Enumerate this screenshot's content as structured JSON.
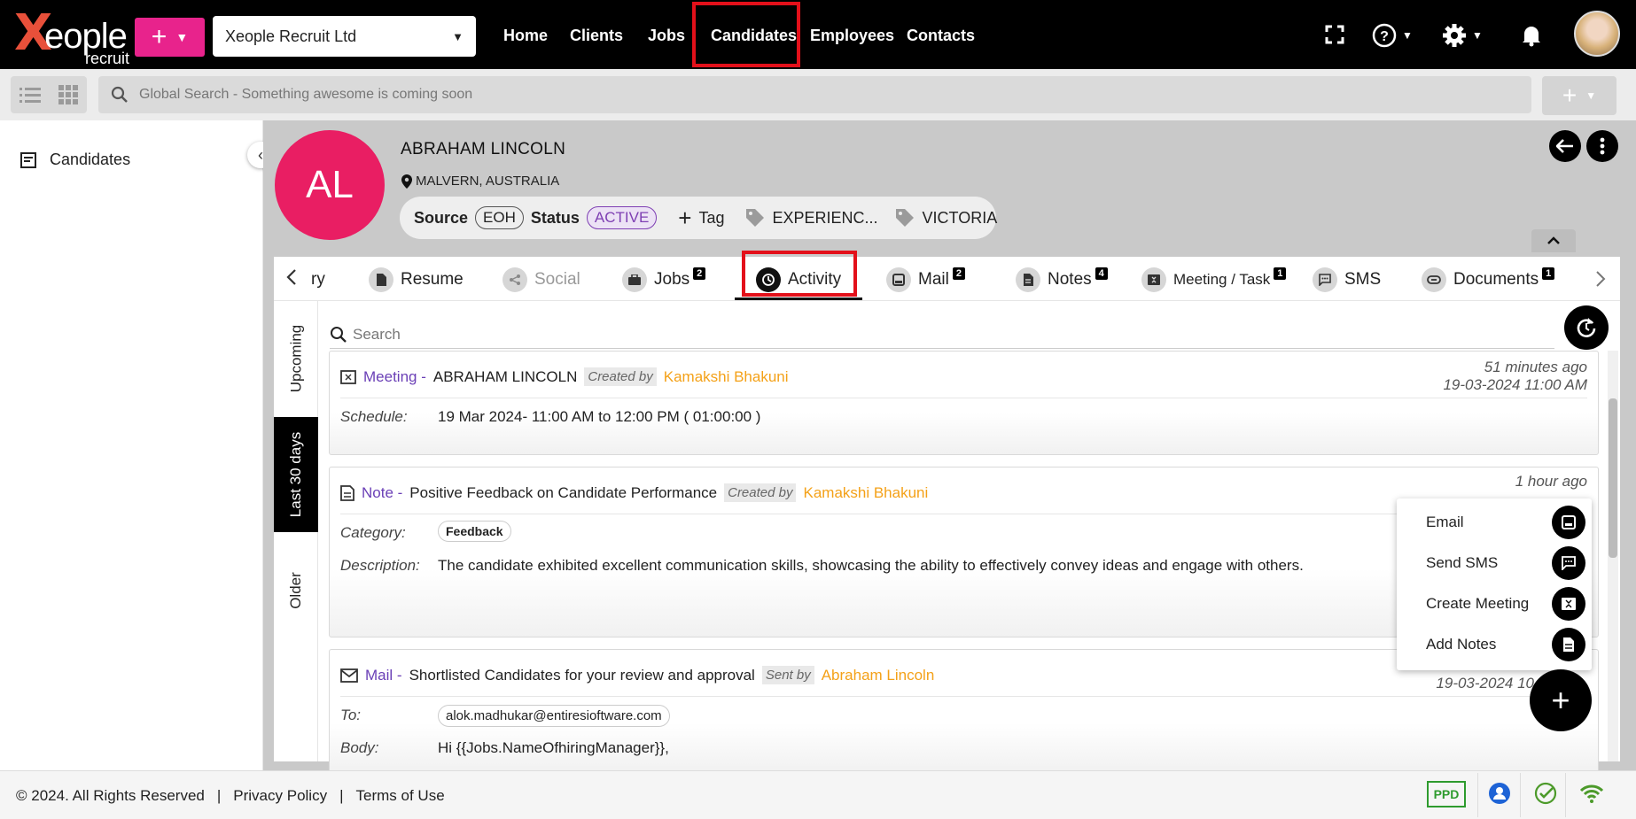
{
  "app": {
    "logo_word": "eople",
    "logo_sub": "recruit",
    "company": "Xeople Recruit Ltd"
  },
  "nav": {
    "home": "Home",
    "clients": "Clients",
    "jobs": "Jobs",
    "candidates": "Candidates",
    "employees": "Employees",
    "contacts": "Contacts"
  },
  "search": {
    "placeholder": "Global Search - Something awesome is coming soon"
  },
  "sidebar": {
    "items": [
      {
        "label": "Candidates",
        "icon": "list-card-icon"
      }
    ]
  },
  "candidate": {
    "initials": "AL",
    "name": "ABRAHAM LINCOLN",
    "location": "MALVERN, AUSTRALIA",
    "source_label": "Source",
    "source_value": "EOH",
    "status_label": "Status",
    "status_value": "ACTIVE",
    "tag_label": "Tag",
    "tags": [
      "EXPERIENC...",
      "VICTORIA"
    ]
  },
  "tabs": [
    {
      "label": "ry"
    },
    {
      "label": "Resume"
    },
    {
      "label": "Social"
    },
    {
      "label": "Jobs",
      "badge": "2"
    },
    {
      "label": "Activity"
    },
    {
      "label": "Mail",
      "badge": "2"
    },
    {
      "label": "Notes",
      "badge": "4"
    },
    {
      "label": "Meeting / Task",
      "badge": "1"
    },
    {
      "label": "SMS"
    },
    {
      "label": "Documents",
      "badge": "1"
    }
  ],
  "vtabs": {
    "upcoming": "Upcoming",
    "last30": "Last 30 days",
    "older": "Older"
  },
  "inner_search": {
    "placeholder": "Search"
  },
  "activities": [
    {
      "type": "Meeting -",
      "title": "ABRAHAM LINCOLN",
      "by_label": "Created by",
      "by": "Kamakshi Bhakuni",
      "time_ago": "51 minutes ago",
      "datetime": "19-03-2024 11:00 AM",
      "schedule_label": "Schedule:",
      "schedule": "19 Mar 2024- 11:00 AM to 12:00 PM ( 01:00:00 )"
    },
    {
      "type": "Note -",
      "title": "Positive Feedback on Candidate Performance",
      "by_label": "Created by",
      "by": "Kamakshi Bhakuni",
      "time_ago": "1 hour ago",
      "category_label": "Category:",
      "category": "Feedback",
      "description_label": "Description:",
      "description": "The candidate exhibited excellent communication skills, showcasing the ability to effectively convey ideas and engage with others."
    },
    {
      "type": "Mail -",
      "title": "Shortlisted Candidates for your review and approval",
      "by_label": "Sent by",
      "by": "Abraham Lincoln",
      "datetime": "19-03-2024 10",
      "to_label": "To:",
      "to": "alok.madhukar@entiresioftware.com",
      "body_label": "Body:",
      "body": "Hi {{Jobs.NameOfhiringManager}},"
    }
  ],
  "quick_menu": [
    {
      "label": "Email",
      "icon": "email-icon"
    },
    {
      "label": "Send SMS",
      "icon": "sms-icon"
    },
    {
      "label": "Create Meeting",
      "icon": "meeting-icon"
    },
    {
      "label": "Add Notes",
      "icon": "note-icon"
    }
  ],
  "footer": {
    "copyright": "© 2024. All Rights Reserved",
    "sep": "|",
    "privacy": "Privacy Policy",
    "terms": "Terms of Use",
    "ppd": "PPD"
  },
  "colors": {
    "brand_pink": "#e8238c",
    "avatar_pink": "#e91e63",
    "purple": "#6a3fb6",
    "orange": "#f4a118",
    "highlight_red": "#e3101a",
    "green": "#2e9b2e"
  }
}
